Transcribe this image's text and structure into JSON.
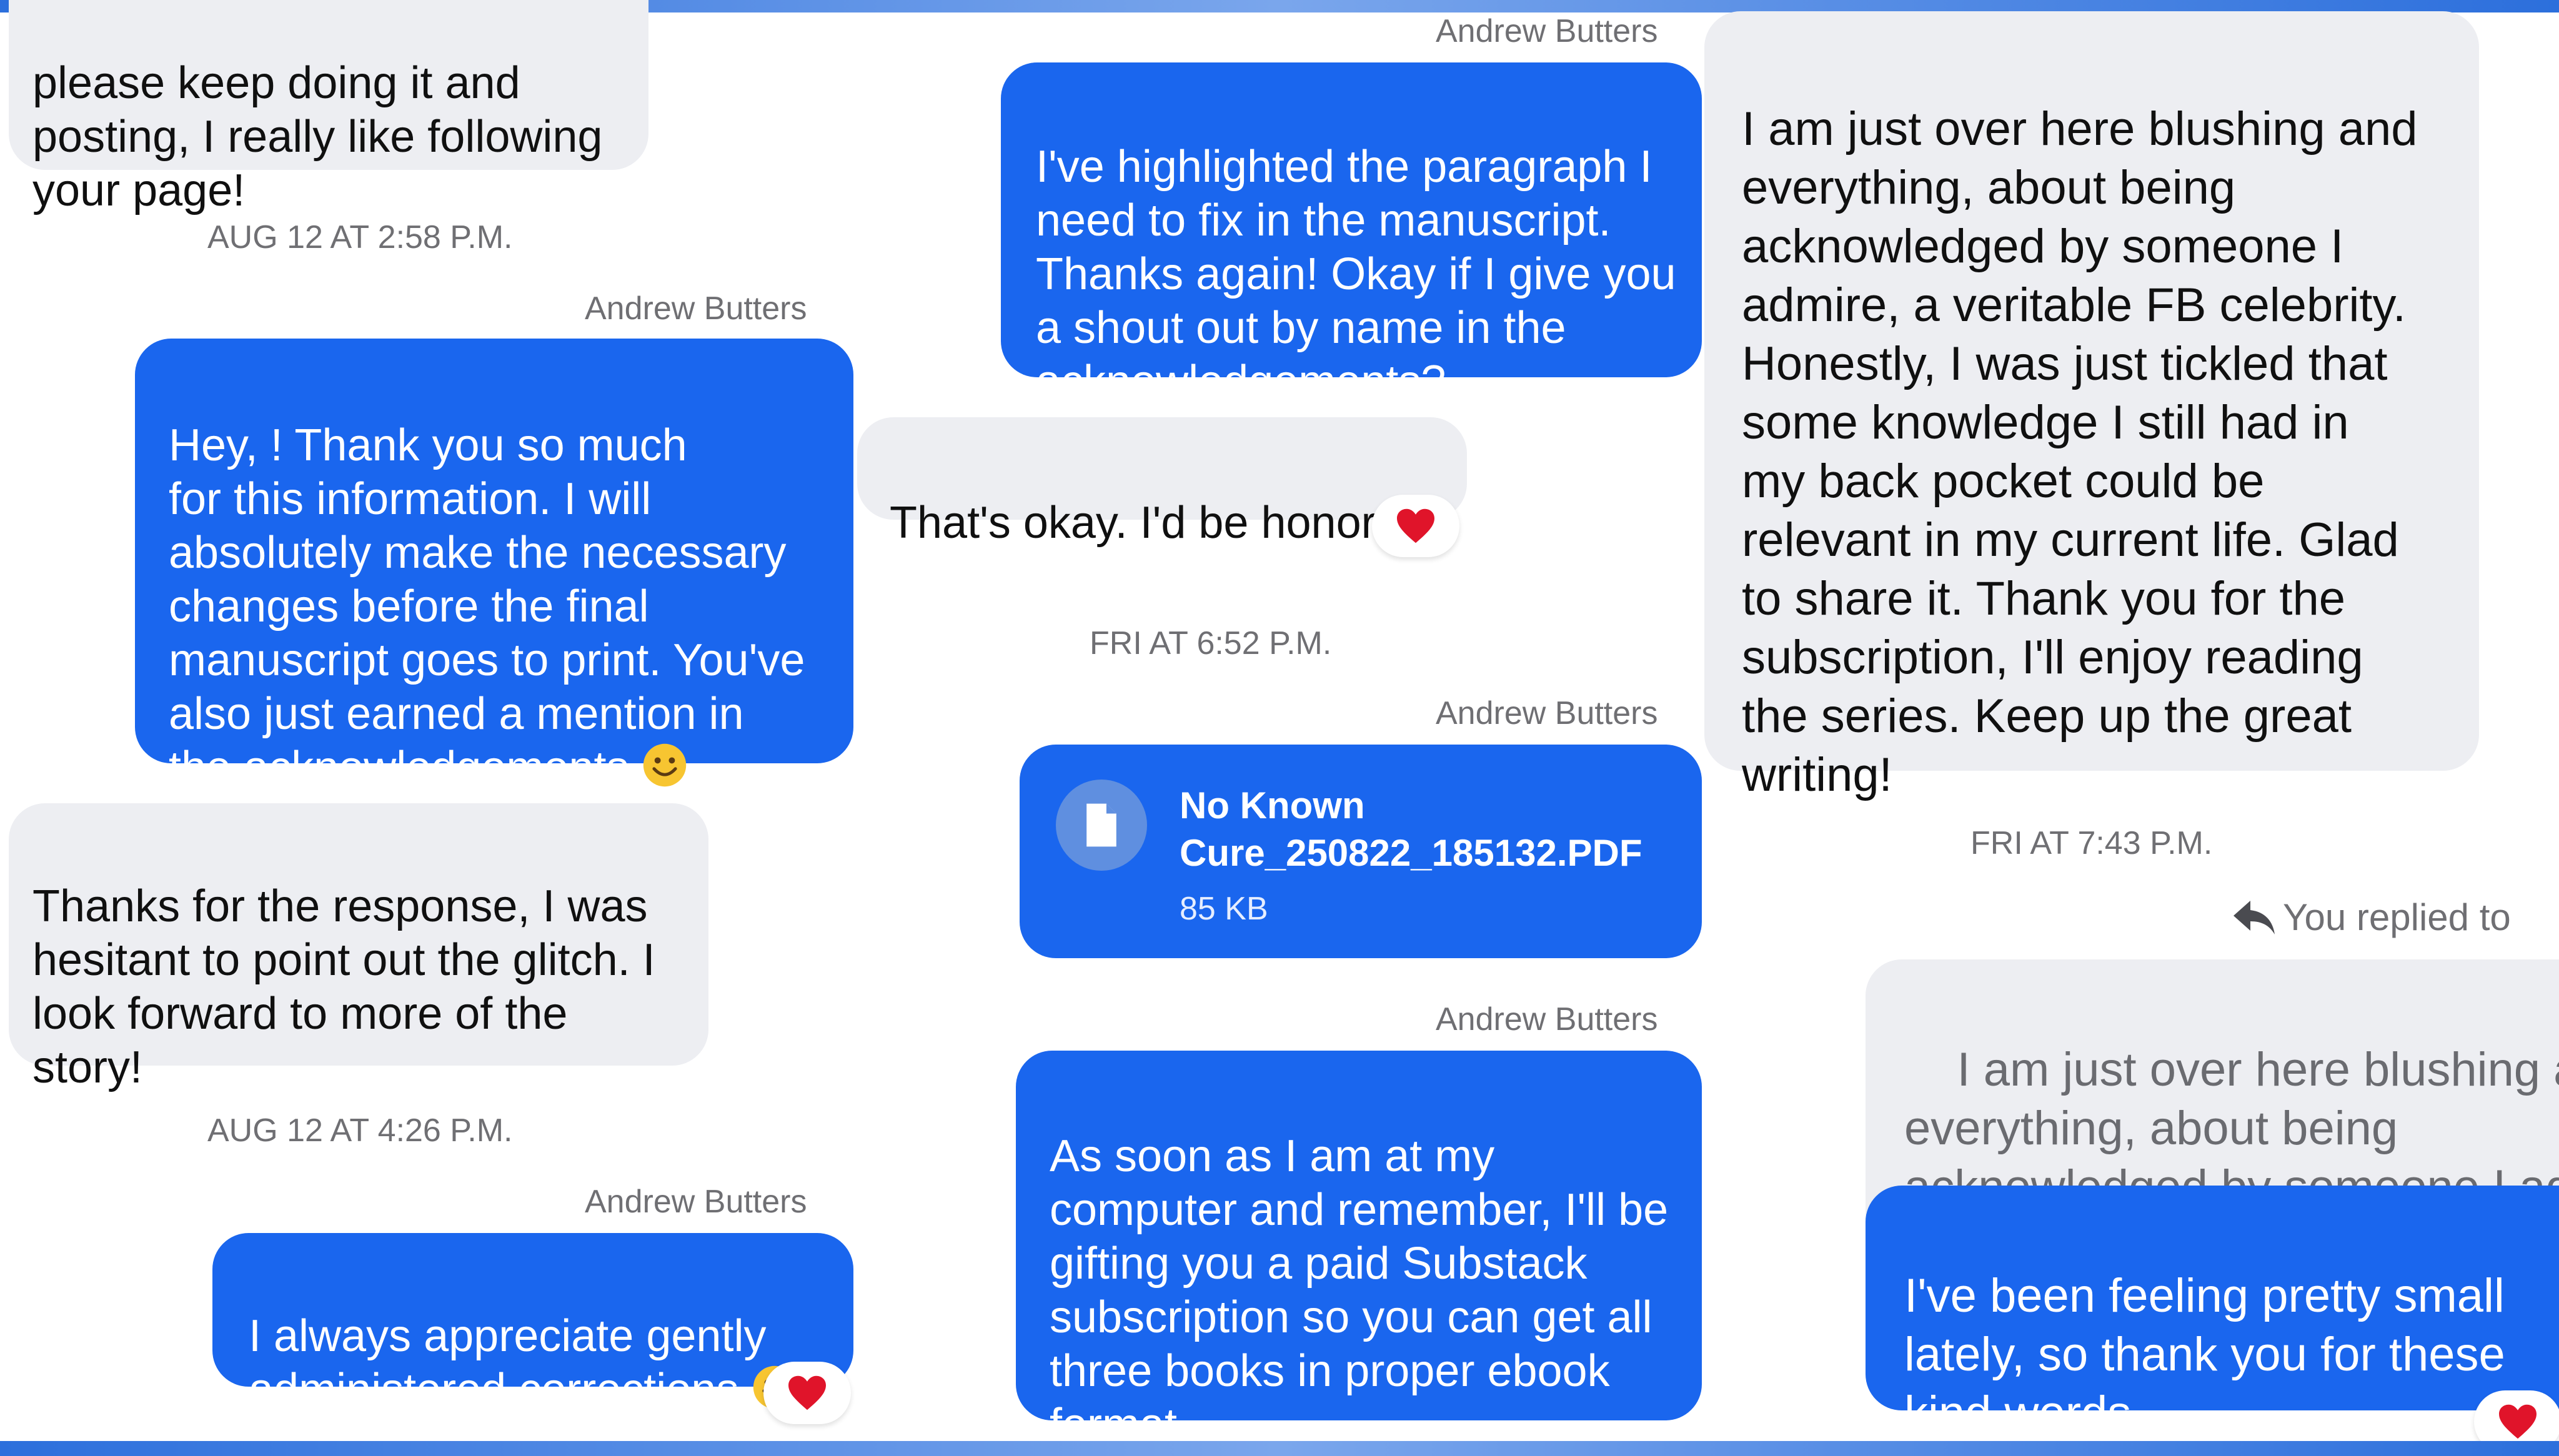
{
  "column_left": {
    "msg_partial_top": "please keep doing it and\nposting, I really like following\nyour page!",
    "timestamp_1": "AUG 12 AT 2:58 P.M.",
    "sender_1": "Andrew Butters",
    "msg_out_1_a": "Hey,           ! Thank you so much\nfor this information. I will\nabsolutely make the necessary\nchanges before the final\nmanuscript goes to print. You've\nalso just earned a mention in\nthe acknowledgements ",
    "msg_in_2": "Thanks for the response, I was\nhesitant to point out the glitch. I\nlook forward to more of the\nstory!",
    "timestamp_2": "AUG 12 AT 4:26 P.M.",
    "sender_2": "Andrew Butters",
    "msg_out_2": "I always appreciate gently\nadministered corrections "
  },
  "column_middle": {
    "sender_1": "Andrew Butters",
    "msg_out_1": "I've highlighted the paragraph I\nneed to fix in the manuscript.\nThanks again! Okay if I give you\na shout out by name in the\nacknowledgements?",
    "msg_in_1": "That's okay. I'd be honored.",
    "timestamp_1": "FRI AT 6:52 P.M.",
    "sender_2": "Andrew Butters",
    "attachment": {
      "name": "No Known\nCure_250822_185132.PDF",
      "size": "85 KB",
      "icon": "document-icon"
    },
    "sender_3": "Andrew Butters",
    "msg_out_2": "As soon as I am at my\ncomputer and remember, I'll be\ngifting you a paid Substack\nsubscription so you can get all\nthree books in proper ebook\nformat."
  },
  "column_right": {
    "msg_in_1": "I am just over here blushing and\neverything, about being\nacknowledged by someone I\nadmire, a veritable FB celebrity.\nHonestly, I was just tickled that\nsome knowledge I still had in\nmy back pocket could be\nrelevant in my current  life. Glad\nto share it. Thank you for the\nsubscription, I'll enjoy reading\nthe series. Keep up the great\nwriting!",
    "timestamp_1": "FRI AT 7:43 P.M.",
    "reply_label": "You replied to",
    "quoted_text": "I am just over here blushing and\neverything, about being\nacknowledged by someone I admire",
    "msg_out_1": "I've been feeling pretty small\nlately, so thank you for these\nkind words."
  },
  "colors": {
    "outgoing_bubble": "#1a66ee",
    "incoming_bubble": "#edeef2",
    "reaction_heart": "#e0142a",
    "frame_accent": "#2c6fdc"
  },
  "reactions": [
    "heart-reaction",
    "heart-reaction",
    "heart-reaction"
  ]
}
